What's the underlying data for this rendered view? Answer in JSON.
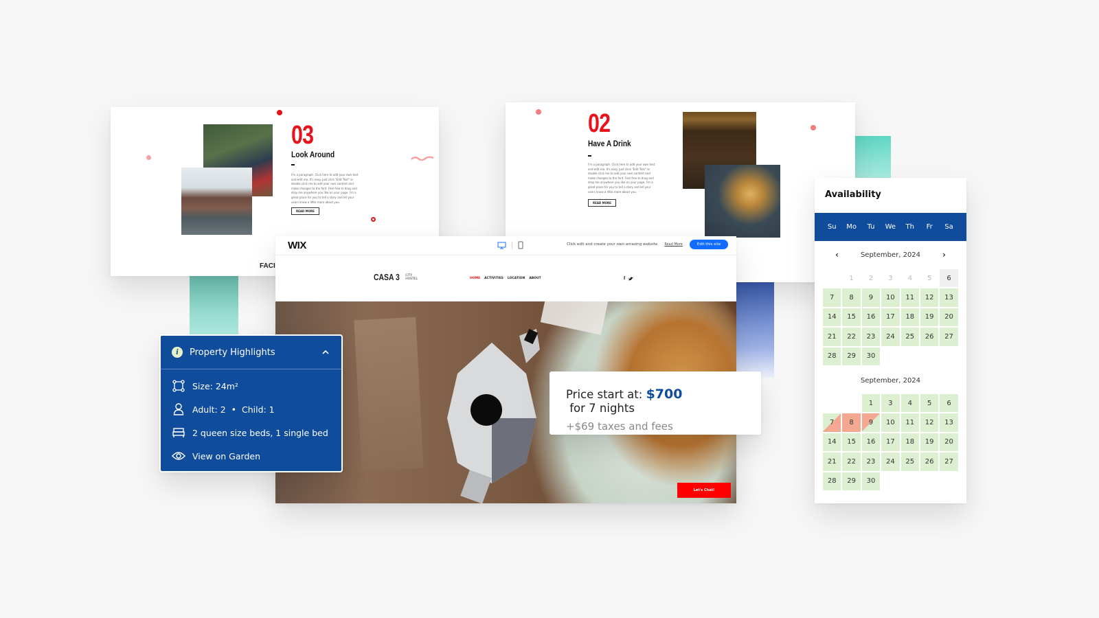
{
  "slides": {
    "slide03": {
      "number": "03",
      "title": "Look Around",
      "paragraph": "I'm a paragraph. Click here to add your own text and edit me. It's easy. Just click \"Edit Text\" or double click me to add your own content and make changes to the font. Feel free to drag and drop me anywhere you like on your page. I'm a great place for you to tell a story and let your users know a little more about you.",
      "button": "READ MORE",
      "footer_text": "FACIL"
    },
    "slide02": {
      "number": "02",
      "title": "Have A Drink",
      "paragraph": "I'm a paragraph. Click here to add your own text and edit me. It's easy. Just click \"Edit Text\" or double click me to add your own content and make changes to the font. Feel free to drag and drop me anywhere you like on your page. I'm a great place for you to tell a story and let your users know a little more about you.",
      "button": "READ MORE"
    }
  },
  "browser": {
    "wix_logo": "WIX",
    "tagline": "Click edit and create your own amazing website",
    "read_more": "Read More",
    "edit_button": "Edit this site",
    "site": {
      "logo_main": "CASA 3",
      "logo_sub_1": "CITY",
      "logo_sub_2": "HOSTEL",
      "nav": [
        "HOME",
        "ACTIVITIES",
        "LOCATION",
        "ABOUT"
      ],
      "social": [
        "f",
        "t"
      ],
      "chat_button": "Let's Chat!"
    }
  },
  "highlights": {
    "title": "Property Highlights",
    "items": [
      {
        "icon": "size-icon",
        "text": "Size: 24m²"
      },
      {
        "icon": "person-icon",
        "text": "Adult: 2  •  Child: 1"
      },
      {
        "icon": "bed-icon",
        "text": "2 queen size beds, 1 single bed"
      },
      {
        "icon": "eye-icon",
        "text": "View on Garden"
      }
    ]
  },
  "price": {
    "prefix": "Price start at: ",
    "amount": "$700",
    "suffix": " for 7 nights",
    "taxes": "+$69 taxes and fees"
  },
  "availability": {
    "title": "Availability",
    "weekdays": [
      "Su",
      "Mo",
      "Tu",
      "We",
      "Th",
      "Fr",
      "Sa"
    ],
    "month1": {
      "label": "September, 2024",
      "cells": [
        {
          "d": "",
          "s": "empty"
        },
        {
          "d": "1",
          "s": "muted"
        },
        {
          "d": "2",
          "s": "muted"
        },
        {
          "d": "3",
          "s": "muted"
        },
        {
          "d": "4",
          "s": "muted"
        },
        {
          "d": "5",
          "s": "muted"
        },
        {
          "d": "6",
          "s": "today"
        },
        {
          "d": "7",
          "s": "avail"
        },
        {
          "d": "8",
          "s": "avail"
        },
        {
          "d": "9",
          "s": "avail"
        },
        {
          "d": "10",
          "s": "avail"
        },
        {
          "d": "11",
          "s": "avail"
        },
        {
          "d": "12",
          "s": "avail"
        },
        {
          "d": "13",
          "s": "avail"
        },
        {
          "d": "14",
          "s": "avail"
        },
        {
          "d": "15",
          "s": "avail"
        },
        {
          "d": "16",
          "s": "avail"
        },
        {
          "d": "17",
          "s": "avail"
        },
        {
          "d": "18",
          "s": "avail"
        },
        {
          "d": "19",
          "s": "avail"
        },
        {
          "d": "20",
          "s": "avail"
        },
        {
          "d": "21",
          "s": "avail"
        },
        {
          "d": "22",
          "s": "avail"
        },
        {
          "d": "23",
          "s": "avail"
        },
        {
          "d": "24",
          "s": "avail"
        },
        {
          "d": "25",
          "s": "avail"
        },
        {
          "d": "26",
          "s": "avail"
        },
        {
          "d": "27",
          "s": "avail"
        },
        {
          "d": "28",
          "s": "avail"
        },
        {
          "d": "29",
          "s": "avail"
        },
        {
          "d": "30",
          "s": "avail"
        }
      ]
    },
    "month2": {
      "label": "September, 2024",
      "cells": [
        {
          "d": "",
          "s": "empty"
        },
        {
          "d": "",
          "s": "empty"
        },
        {
          "d": "1",
          "s": "avail"
        },
        {
          "d": "3",
          "s": "avail"
        },
        {
          "d": "4",
          "s": "avail"
        },
        {
          "d": "5",
          "s": "avail"
        },
        {
          "d": "6",
          "s": "avail"
        },
        {
          "d": "7",
          "s": "checkin"
        },
        {
          "d": "8",
          "s": "booked"
        },
        {
          "d": "9",
          "s": "checkout"
        },
        {
          "d": "10",
          "s": "avail"
        },
        {
          "d": "11",
          "s": "avail"
        },
        {
          "d": "12",
          "s": "avail"
        },
        {
          "d": "13",
          "s": "avail"
        },
        {
          "d": "14",
          "s": "avail"
        },
        {
          "d": "15",
          "s": "avail"
        },
        {
          "d": "16",
          "s": "avail"
        },
        {
          "d": "17",
          "s": "avail"
        },
        {
          "d": "18",
          "s": "avail"
        },
        {
          "d": "19",
          "s": "avail"
        },
        {
          "d": "20",
          "s": "avail"
        },
        {
          "d": "21",
          "s": "avail"
        },
        {
          "d": "22",
          "s": "avail"
        },
        {
          "d": "23",
          "s": "avail"
        },
        {
          "d": "24",
          "s": "avail"
        },
        {
          "d": "25",
          "s": "avail"
        },
        {
          "d": "26",
          "s": "avail"
        },
        {
          "d": "27",
          "s": "avail"
        },
        {
          "d": "28",
          "s": "avail"
        },
        {
          "d": "29",
          "s": "avail"
        },
        {
          "d": "30",
          "s": "avail"
        }
      ]
    }
  },
  "colors": {
    "brand_blue": "#0f4c9c",
    "accent_red": "#e8121b",
    "wix_blue": "#116dff",
    "available_green": "#dcefd0",
    "booked_salmon": "#f5a891"
  }
}
